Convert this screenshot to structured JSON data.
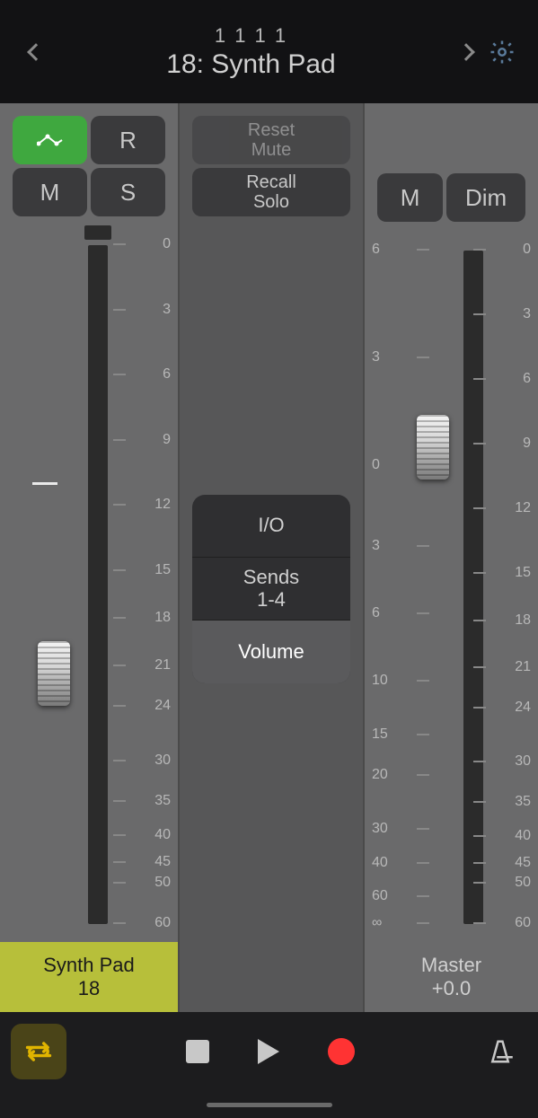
{
  "header": {
    "counter": "1   1   1      1",
    "title": "18: Synth Pad"
  },
  "track": {
    "buttons": {
      "automation": "",
      "r": "R",
      "m": "M",
      "s": "S"
    },
    "scale_right": [
      {
        "p": 0,
        "v": "0"
      },
      {
        "p": 9.6,
        "v": "3"
      },
      {
        "p": 19.2,
        "v": "6"
      },
      {
        "p": 28.8,
        "v": "9"
      },
      {
        "p": 38.4,
        "v": "12"
      },
      {
        "p": 48,
        "v": "15"
      },
      {
        "p": 55,
        "v": "18"
      },
      {
        "p": 62,
        "v": "21"
      },
      {
        "p": 68,
        "v": "24"
      },
      {
        "p": 76,
        "v": "30"
      },
      {
        "p": 82,
        "v": "35"
      },
      {
        "p": 87,
        "v": "40"
      },
      {
        "p": 91,
        "v": "45"
      },
      {
        "p": 94,
        "v": "50"
      },
      {
        "p": 100,
        "v": "60"
      }
    ],
    "fader_pos_pct": 65,
    "zero_line_pct": 36,
    "label_name": "Synth Pad",
    "label_num": "18"
  },
  "mid": {
    "reset_mute": "Reset\nMute",
    "recall_solo": "Recall\nSolo",
    "view": {
      "io": "I/O",
      "sends": "Sends\n1-4",
      "volume": "Volume",
      "selected": "volume"
    }
  },
  "master": {
    "buttons": {
      "m": "M",
      "dim": "Dim"
    },
    "scale_left": [
      {
        "p": 0,
        "v": "6"
      },
      {
        "p": 16,
        "v": "3"
      },
      {
        "p": 32,
        "v": "0"
      },
      {
        "p": 44,
        "v": "3"
      },
      {
        "p": 54,
        "v": "6"
      },
      {
        "p": 64,
        "v": "10"
      },
      {
        "p": 72,
        "v": "15"
      },
      {
        "p": 78,
        "v": "20"
      },
      {
        "p": 86,
        "v": "30"
      },
      {
        "p": 91,
        "v": "40"
      },
      {
        "p": 96,
        "v": "60"
      },
      {
        "p": 100,
        "v": "∞"
      }
    ],
    "scale_right": [
      {
        "p": 0,
        "v": "0"
      },
      {
        "p": 9.6,
        "v": "3"
      },
      {
        "p": 19.2,
        "v": "6"
      },
      {
        "p": 28.8,
        "v": "9"
      },
      {
        "p": 38.4,
        "v": "12"
      },
      {
        "p": 48,
        "v": "15"
      },
      {
        "p": 55,
        "v": "18"
      },
      {
        "p": 62,
        "v": "21"
      },
      {
        "p": 68,
        "v": "24"
      },
      {
        "p": 76,
        "v": "30"
      },
      {
        "p": 82,
        "v": "35"
      },
      {
        "p": 87,
        "v": "40"
      },
      {
        "p": 91,
        "v": "45"
      },
      {
        "p": 94,
        "v": "50"
      },
      {
        "p": 100,
        "v": "60"
      }
    ],
    "fader_pos_pct": 30,
    "label_name": "Master",
    "label_val": "+0.0"
  }
}
